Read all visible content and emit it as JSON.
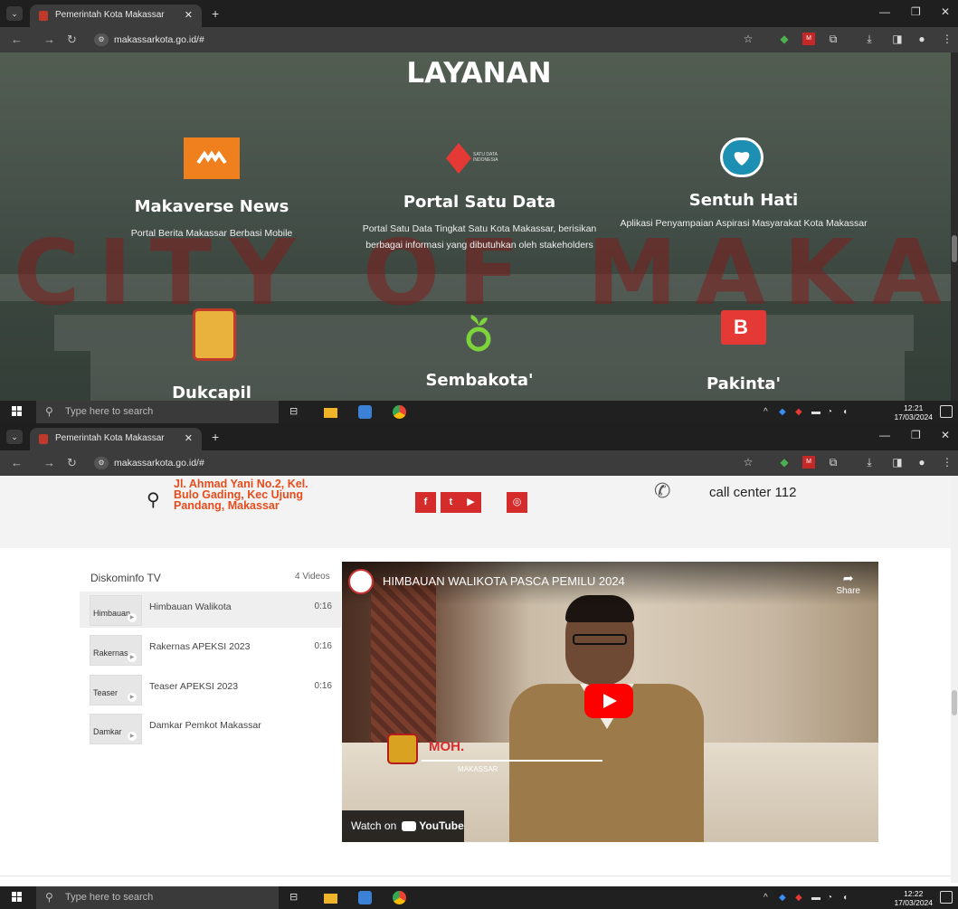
{
  "browser": {
    "tab_title": "Pemerintah Kota Makassar",
    "url": "makassarkota.go.id/#"
  },
  "screen1": {
    "heading": "LAYANAN",
    "services_row1": [
      {
        "name": "Makaverse News",
        "desc": "Portal Berita Makassar Berbasi Mobile",
        "logo": "makaverse-logo"
      },
      {
        "name": "Portal Satu Data",
        "desc": "Portal Satu Data Tingkat Satu Kota Makassar, berisikan berbagai informasi yang dibutuhkan oleh stakeholders",
        "logo": "satu-data-logo"
      },
      {
        "name": "Sentuh Hati",
        "desc": "Aplikasi Penyampaian Aspirasi Masyarakat Kota Makassar",
        "logo": "sentuh-hati-logo"
      }
    ],
    "services_row2": [
      {
        "name": "Dukcapil",
        "logo": "dukcapil-logo"
      },
      {
        "name": "Sembakota'",
        "logo": "sembakota-logo"
      },
      {
        "name": "Pakinta'",
        "logo": "pakinta-logo"
      }
    ],
    "satu_data_text": "SATU DATA INDONESIA",
    "background_text": "CITY OF MAKASSAR",
    "taskbar": {
      "search_placeholder": "Type here to search",
      "time": "12:21",
      "date": "17/03/2024"
    }
  },
  "screen2": {
    "address": [
      "Jl. Ahmad Yani No.2, Kel.",
      "Bulo Gading, Kec Ujung",
      "Pandang, Makassar"
    ],
    "social": [
      "f",
      "t",
      "yt",
      "ig"
    ],
    "call_center": "call center 112",
    "playlist": {
      "title": "Diskominfo TV",
      "count": "4 Videos",
      "items": [
        {
          "title": "Himbauan Walikota",
          "duration": "0:16",
          "thumb": "Himbauan"
        },
        {
          "title": "Rakernas APEKSI 2023",
          "duration": "0:16",
          "thumb": "Rakernas"
        },
        {
          "title": "Teaser APEKSI 2023",
          "duration": "0:16",
          "thumb": "Teaser"
        },
        {
          "title": "Damkar Pemkot Makassar",
          "duration": "",
          "thumb": "Damkar"
        }
      ]
    },
    "video": {
      "title": "HIMBAUAN WALIKOTA PASCA PEMILU 2024",
      "share": "Share",
      "overlay_name": "MOH.",
      "overlay_sub": "MAKASSAR",
      "watch_on": "Watch on",
      "youtube": "YouTube"
    },
    "taskbar": {
      "search_placeholder": "Type here to search",
      "time": "12:22",
      "date": "17/03/2024"
    }
  }
}
